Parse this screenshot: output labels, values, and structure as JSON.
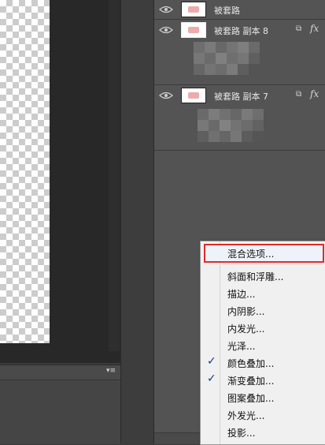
{
  "layers": [
    {
      "name": "被套路",
      "link_icon": "",
      "fx": ""
    },
    {
      "name": "被套路 副本 8",
      "link_icon": "⧉",
      "fx": "fx"
    },
    {
      "name": "被套路 副本 7",
      "link_icon": "⧉",
      "fx": "fx"
    }
  ],
  "panel": {
    "menu_glyph": "▾≡"
  },
  "context_menu": {
    "items": [
      {
        "label": "混合选项...",
        "checked": false
      },
      {
        "label": "斜面和浮雕...",
        "checked": false
      },
      {
        "label": "描边...",
        "checked": false
      },
      {
        "label": "内阴影...",
        "checked": false
      },
      {
        "label": "内发光...",
        "checked": false
      },
      {
        "label": "光泽...",
        "checked": false
      },
      {
        "label": "颜色叠加...",
        "checked": true
      },
      {
        "label": "渐变叠加...",
        "checked": true
      },
      {
        "label": "图案叠加...",
        "checked": false
      },
      {
        "label": "外发光...",
        "checked": false
      },
      {
        "label": "投影...",
        "checked": false
      }
    ],
    "check_glyph": "✓"
  },
  "colors": {
    "panel_bg": "#535353",
    "menu_bg": "#f0f0f0",
    "highlight_border": "#e32a2a",
    "check": "#1b3a8c"
  }
}
